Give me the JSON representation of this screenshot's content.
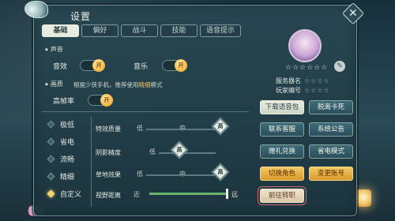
{
  "window": {
    "title": "设置"
  },
  "tabs": [
    {
      "label": "基础",
      "active": true
    },
    {
      "label": "偏好",
      "active": false
    },
    {
      "label": "战斗",
      "active": false
    },
    {
      "label": "技能",
      "active": false
    },
    {
      "label": "语音提示",
      "active": false
    }
  ],
  "sound": {
    "section": "声音",
    "effects_label": "音效",
    "music_label": "音乐",
    "toggle_on": "开"
  },
  "graphics": {
    "section": "画质",
    "hint_prefix": "根据少侠手机，推荐使用",
    "hint_highlight": "精细",
    "hint_suffix": "模式",
    "high_fps_label": "高帧率"
  },
  "presets": [
    {
      "label": "极低",
      "selected": false
    },
    {
      "label": "省电",
      "selected": false
    },
    {
      "label": "流畅",
      "selected": false
    },
    {
      "label": "精细",
      "selected": false
    },
    {
      "label": "自定义",
      "selected": true
    }
  ],
  "custom": {
    "level_low": "低",
    "level_mid": "中",
    "level_high": "高",
    "rows": [
      {
        "label": "特效质量",
        "level": "高"
      },
      {
        "label": "阴影精度",
        "level": "高"
      },
      {
        "label": "草地效果",
        "level": "高"
      }
    ],
    "view_distance": {
      "label": "视野距离",
      "near": "近",
      "far": "远",
      "fraction": 1.0
    }
  },
  "profile": {
    "name_masked": "☆☆☆☆☆☆",
    "server_label": "服务器名",
    "server_value": "☆☆☆☆",
    "player_label": "玩家编号",
    "player_value": "☆☆☆☆"
  },
  "buttons": {
    "download_voice": "下载语音包",
    "unstuck": "脱离卡死",
    "contact_support": "联系客服",
    "system_notice": "系统公告",
    "gift_redeem": "赠礼兑换",
    "power_saving": "省电模式",
    "switch_character": "切换角色",
    "change_account": "变更账号",
    "class_transfer": "前往转职"
  },
  "colors": {
    "accent_gold": "#f3b43a",
    "panel_bg": "#284752",
    "slider_green": "#6ab36a",
    "highlight_red": "#d46a6a"
  }
}
